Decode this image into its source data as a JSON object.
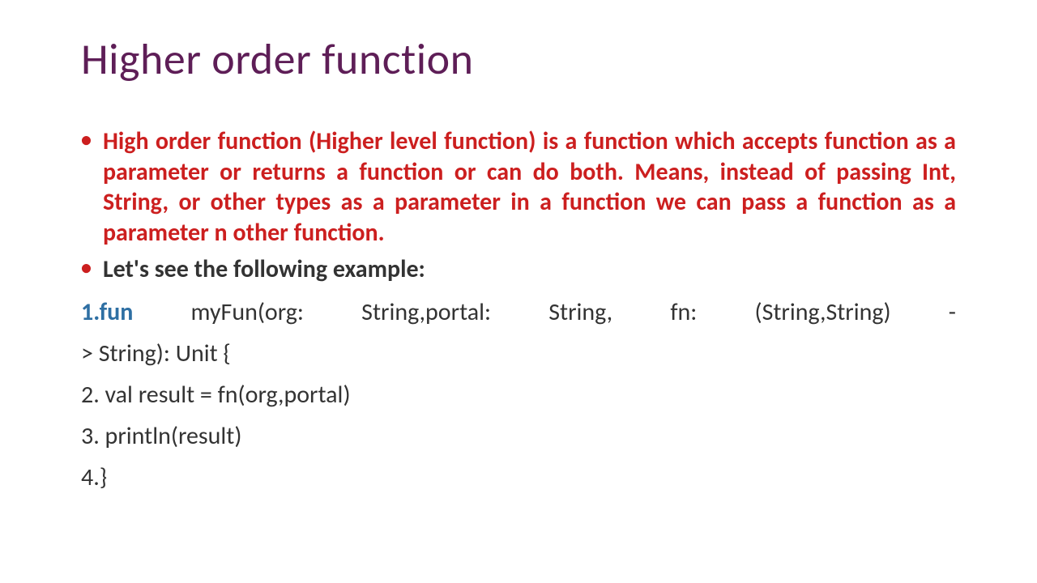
{
  "title": "Higher order function",
  "bullet1_bold": "High order function (Higher level function)",
  "bullet1_rest": " is a function which accepts function as a parameter or returns a function or can do both. Means, instead of passing Int, String, or other types as a parameter in a function we can pass a function as a parameter n other function.",
  "bullet2": "Let's see the following example:",
  "code": {
    "n1": "1.",
    "kw1": "fun",
    "l1a": " myFun(org: String,portal: String, fn: (String,String) -",
    "l1b": "> String): Unit {",
    "l2": "2.    val result = fn(org,portal)",
    "l3": "3.    println(result)",
    "l4": "4.}"
  }
}
